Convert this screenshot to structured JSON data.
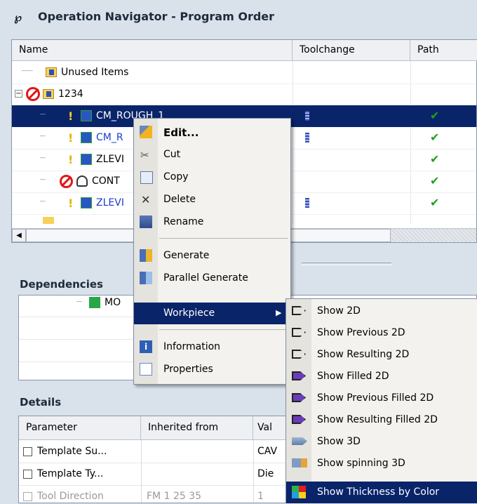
{
  "navigator": {
    "title": "Operation Navigator - Program Order",
    "columns": [
      "Name",
      "Toolchange",
      "Path"
    ],
    "rows": [
      {
        "name": "Unused Items"
      },
      {
        "name": "1234"
      },
      {
        "name": "CM_ROUGH_1"
      },
      {
        "name": "CM_R"
      },
      {
        "name": "ZLEVI"
      },
      {
        "name": "CONT"
      },
      {
        "name": "ZLEVI"
      }
    ]
  },
  "dependencies": {
    "title": "Dependencies",
    "item": "MO"
  },
  "details": {
    "title": "Details",
    "columns": [
      "Parameter",
      "Inherited from",
      "Val"
    ],
    "rows": [
      {
        "param": "Template Su...",
        "inherited": "",
        "value": "CAV"
      },
      {
        "param": "Template Ty...",
        "inherited": "",
        "value": "Die"
      },
      {
        "param": "Tool Direction",
        "inherited": "FM 1 25 35",
        "value": "1"
      }
    ]
  },
  "context_menu": {
    "items": [
      {
        "label": "Edit..."
      },
      {
        "label": "Cut"
      },
      {
        "label": "Copy"
      },
      {
        "label": "Delete"
      },
      {
        "label": "Rename"
      },
      {
        "label": "Generate"
      },
      {
        "label": "Parallel Generate"
      },
      {
        "label": "Workpiece"
      },
      {
        "label": "Information"
      },
      {
        "label": "Properties"
      }
    ]
  },
  "workpiece_submenu": {
    "items": [
      {
        "label": "Show 2D"
      },
      {
        "label": "Show Previous 2D"
      },
      {
        "label": "Show Resulting 2D"
      },
      {
        "label": "Show Filled 2D"
      },
      {
        "label": "Show Previous Filled 2D"
      },
      {
        "label": "Show Resulting Filled 2D"
      },
      {
        "label": "Show 3D"
      },
      {
        "label": "Show spinning 3D"
      },
      {
        "label": "Show Thickness by Color"
      }
    ]
  },
  "colors": {
    "selection": "#0a246a",
    "check": "#1ea11e",
    "menu_highlight": "#0a246a"
  }
}
